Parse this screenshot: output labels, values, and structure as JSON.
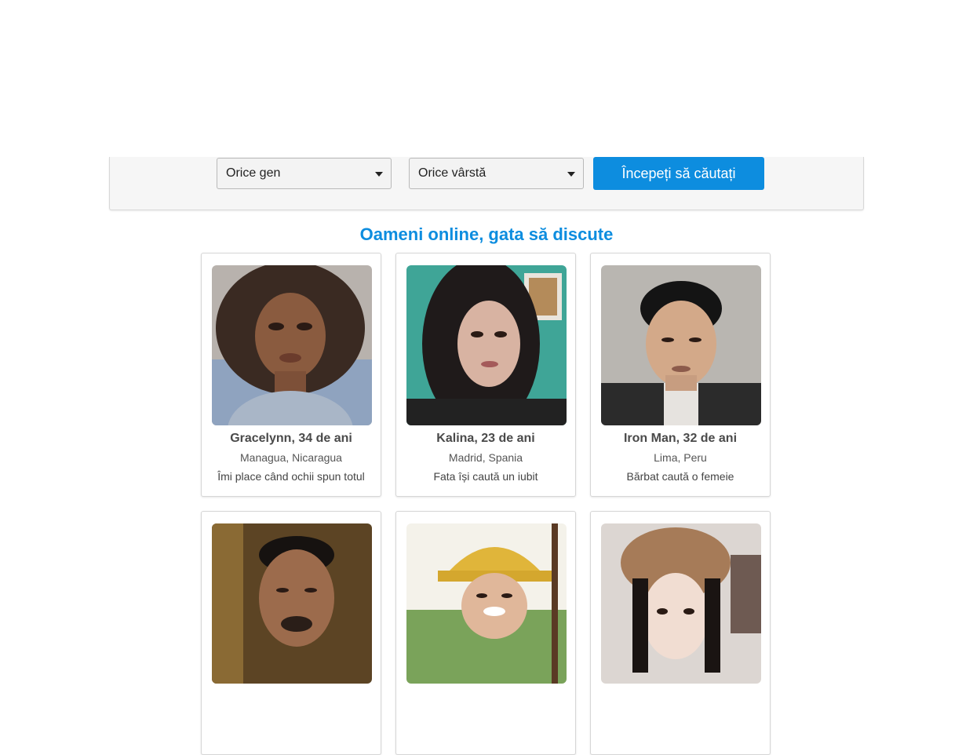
{
  "search": {
    "gender_selected": "Orice gen",
    "age_selected": "Orice vârstă",
    "button_label": "Începeți să căutați"
  },
  "section": {
    "title": "Oameni online, gata să discute"
  },
  "profiles": [
    {
      "name": "Gracelynn, 34 de ani",
      "location": "Managua, Nicaragua",
      "description": "Îmi place când ochii spun totul"
    },
    {
      "name": "Kalina, 23 de ani",
      "location": "Madrid, Spania",
      "description": "Fata își caută un iubit"
    },
    {
      "name": "Iron Man, 32 de ani",
      "location": "Lima, Peru",
      "description": "Bărbat caută o femeie"
    },
    {
      "name": "",
      "location": "",
      "description": ""
    },
    {
      "name": "",
      "location": "",
      "description": ""
    },
    {
      "name": "",
      "location": "",
      "description": ""
    }
  ],
  "colors": {
    "accent": "#0d8ddf"
  }
}
